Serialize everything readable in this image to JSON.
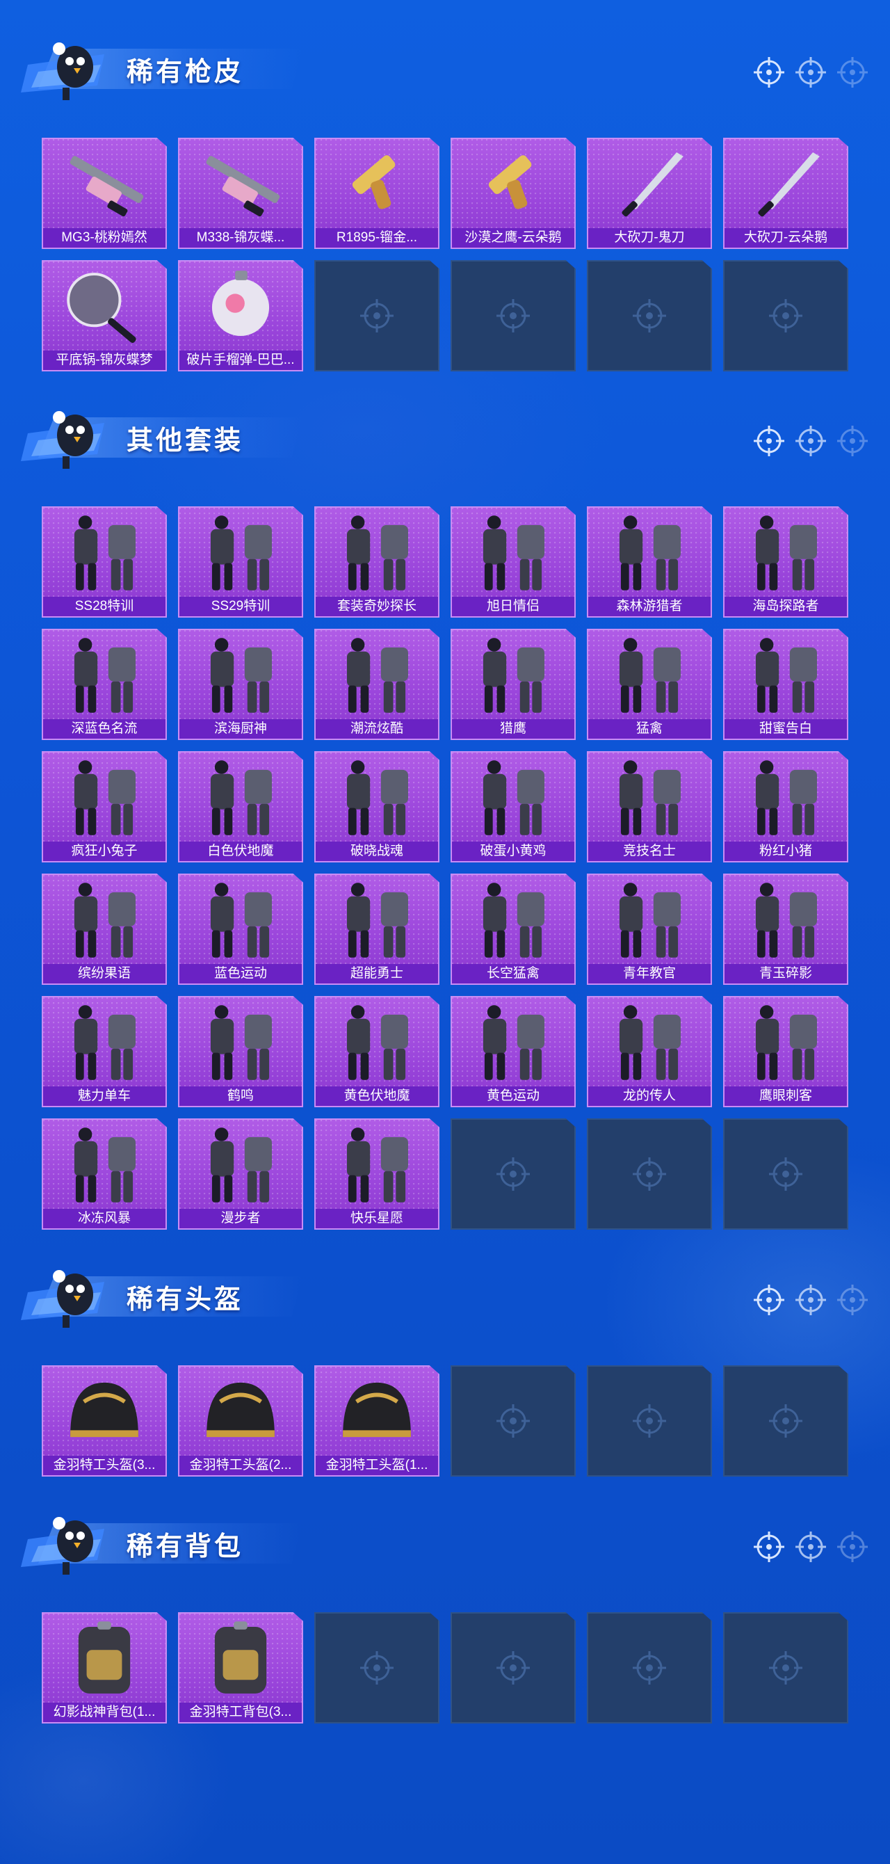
{
  "colors": {
    "card_purple": "#9a45db",
    "card_label_bg": "#6a22c4",
    "empty_slot": "#233f6b",
    "background": "#0d55d6"
  },
  "sections": [
    {
      "title": "稀有枪皮",
      "items": [
        {
          "label": "MG3-桃粉嫣然",
          "icon": "gun-icon"
        },
        {
          "label": "M338-锦灰蝶...",
          "icon": "gun-icon"
        },
        {
          "label": "R1895-镏金...",
          "icon": "pistol-icon"
        },
        {
          "label": "沙漠之鹰-云朵鹅",
          "icon": "pistol-icon"
        },
        {
          "label": "大砍刀-鬼刀",
          "icon": "blade-icon"
        },
        {
          "label": "大砍刀-云朵鹅",
          "icon": "blade-icon"
        },
        {
          "label": "平底锅-锦灰蝶梦",
          "icon": "pan-icon"
        },
        {
          "label": "破片手榴弹-巴巴...",
          "icon": "grenade-icon"
        }
      ],
      "empty_slots": 4
    },
    {
      "title": "其他套装",
      "items": [
        {
          "label": "SS28特训",
          "icon": "outfit-icon"
        },
        {
          "label": "SS29特训",
          "icon": "outfit-icon"
        },
        {
          "label": "套装奇妙探长",
          "icon": "outfit-icon"
        },
        {
          "label": "旭日情侣",
          "icon": "outfit-icon"
        },
        {
          "label": "森林游猎者",
          "icon": "outfit-icon"
        },
        {
          "label": "海岛探路者",
          "icon": "outfit-icon"
        },
        {
          "label": "深蓝色名流",
          "icon": "outfit-icon"
        },
        {
          "label": "滨海厨神",
          "icon": "outfit-icon"
        },
        {
          "label": "潮流炫酷",
          "icon": "outfit-icon"
        },
        {
          "label": "猎鹰",
          "icon": "outfit-icon"
        },
        {
          "label": "猛禽",
          "icon": "outfit-icon"
        },
        {
          "label": "甜蜜告白",
          "icon": "outfit-icon"
        },
        {
          "label": "疯狂小兔子",
          "icon": "outfit-icon"
        },
        {
          "label": "白色伏地魔",
          "icon": "outfit-icon"
        },
        {
          "label": "破晓战魂",
          "icon": "outfit-icon"
        },
        {
          "label": "破蛋小黄鸡",
          "icon": "outfit-icon"
        },
        {
          "label": "竞技名士",
          "icon": "outfit-icon"
        },
        {
          "label": "粉红小猪",
          "icon": "outfit-icon"
        },
        {
          "label": "缤纷果语",
          "icon": "outfit-icon"
        },
        {
          "label": "蓝色运动",
          "icon": "outfit-icon"
        },
        {
          "label": "超能勇士",
          "icon": "outfit-icon"
        },
        {
          "label": "长空猛禽",
          "icon": "outfit-icon"
        },
        {
          "label": "青年教官",
          "icon": "outfit-icon"
        },
        {
          "label": "青玉碎影",
          "icon": "outfit-icon"
        },
        {
          "label": "魅力单车",
          "icon": "outfit-icon"
        },
        {
          "label": "鹤鸣",
          "icon": "outfit-icon"
        },
        {
          "label": "黄色伏地魔",
          "icon": "outfit-icon"
        },
        {
          "label": "黄色运动",
          "icon": "outfit-icon"
        },
        {
          "label": "龙的传人",
          "icon": "outfit-icon"
        },
        {
          "label": "鹰眼刺客",
          "icon": "outfit-icon"
        },
        {
          "label": "冰冻风暴",
          "icon": "outfit-icon"
        },
        {
          "label": "漫步者",
          "icon": "outfit-icon"
        },
        {
          "label": "快乐星愿",
          "icon": "outfit-icon"
        }
      ],
      "empty_slots": 3
    },
    {
      "title": "稀有头盔",
      "items": [
        {
          "label": "金羽特工头盔(3...",
          "icon": "helmet-icon"
        },
        {
          "label": "金羽特工头盔(2...",
          "icon": "helmet-icon"
        },
        {
          "label": "金羽特工头盔(1...",
          "icon": "helmet-icon"
        }
      ],
      "empty_slots": 3
    },
    {
      "title": "稀有背包",
      "items": [
        {
          "label": "幻影战神背包(1...",
          "icon": "backpack-icon"
        },
        {
          "label": "金羽特工背包(3...",
          "icon": "backpack-icon"
        }
      ],
      "empty_slots": 4
    }
  ]
}
